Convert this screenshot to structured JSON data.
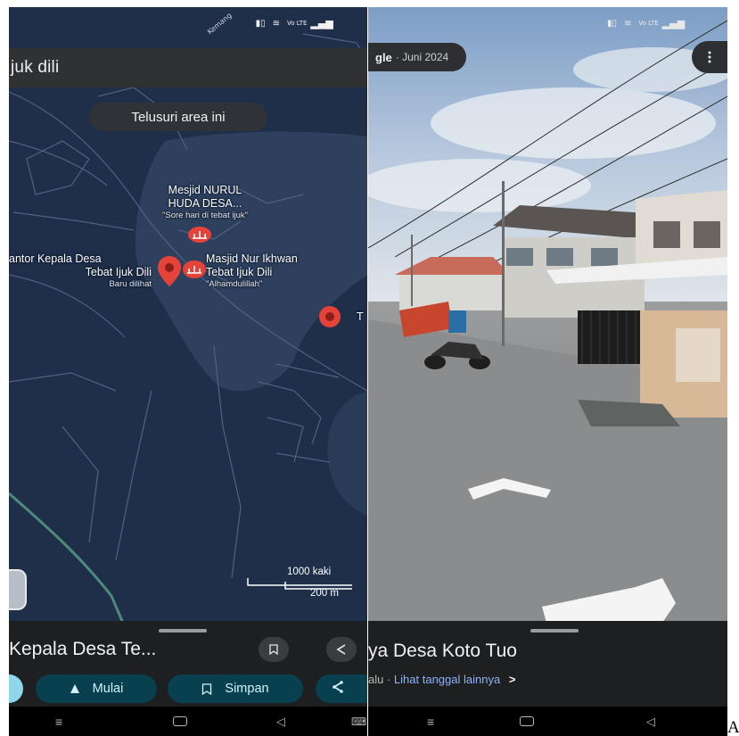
{
  "left_screen": {
    "status_bar": {
      "left_text": "Kemang",
      "right_text": "Vo LTE"
    },
    "search": {
      "value": "juk dili"
    },
    "explore_button": {
      "label": "Telusuri area ini"
    },
    "pois": [
      {
        "name_line1": "Mesjid NURUL",
        "name_line2": "HUDA DESA...",
        "review": "\"Sore hari di tebat ijuk\""
      },
      {
        "name_line1": "antor Kepala Desa",
        "name_line2": "Tebat Ijuk Dili",
        "note": "Baru dilihat"
      },
      {
        "name_line1": "Masjid Nur Ikhwan",
        "name_line2": "Tebat Ijuk Dili",
        "review": "\"Alhamdulillah\""
      },
      {
        "name_line1": "T"
      }
    ],
    "scale": {
      "feet": "1000 kaki",
      "meters": "200 m"
    },
    "place_sheet": {
      "title": "Kepala Desa Te...",
      "actions": [
        {
          "label": "Mulai",
          "icon": "navigate-arrow-icon"
        },
        {
          "label": "Simpan",
          "icon": "bookmark-icon"
        }
      ]
    }
  },
  "right_screen": {
    "status_bar": {
      "right_text": "Vo LTE"
    },
    "imagery_chip": {
      "brand": "gle",
      "date": "· Juni 2024"
    },
    "street_sheet": {
      "title": "ya Desa Koto Tuo",
      "subtitle_prefix": "alu ·",
      "other_dates_link": "Lihat tanggal lainnya",
      "chevron": ">"
    }
  },
  "corner_label": "A",
  "colors": {
    "map_background": "#1f2f4a",
    "poi_red": "#e5423a",
    "action_chip_bg": "#08404f",
    "action_chip_text": "#d4f1f9",
    "link_blue": "#8ab4f8"
  }
}
